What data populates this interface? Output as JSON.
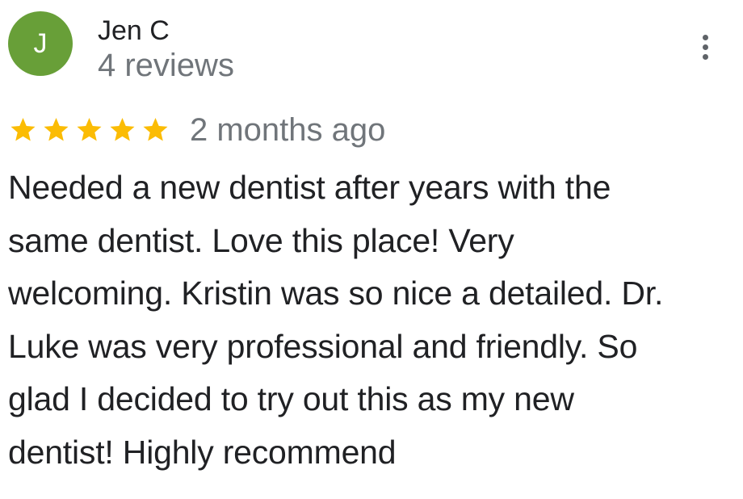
{
  "reviewer": {
    "initial": "J",
    "name": "Jen C",
    "review_count": "4 reviews",
    "avatar_color": "#689f38"
  },
  "menu": {
    "icon": "more-vert-icon"
  },
  "review": {
    "rating": 5,
    "max_rating": 5,
    "star_color": "#fbbc04",
    "date": "2 months ago",
    "text_lines": [
      "Needed a new dentist after years with the",
      "same dentist. Love this place! Very",
      "welcoming. Kristin was so nice a detailed. Dr.",
      "Luke was very professional and friendly. So",
      "glad I decided to try out this as my new",
      "dentist! Highly recommend"
    ]
  },
  "colors": {
    "primary_text": "#202124",
    "secondary_text": "#70757a",
    "icon": "#5f6368"
  }
}
